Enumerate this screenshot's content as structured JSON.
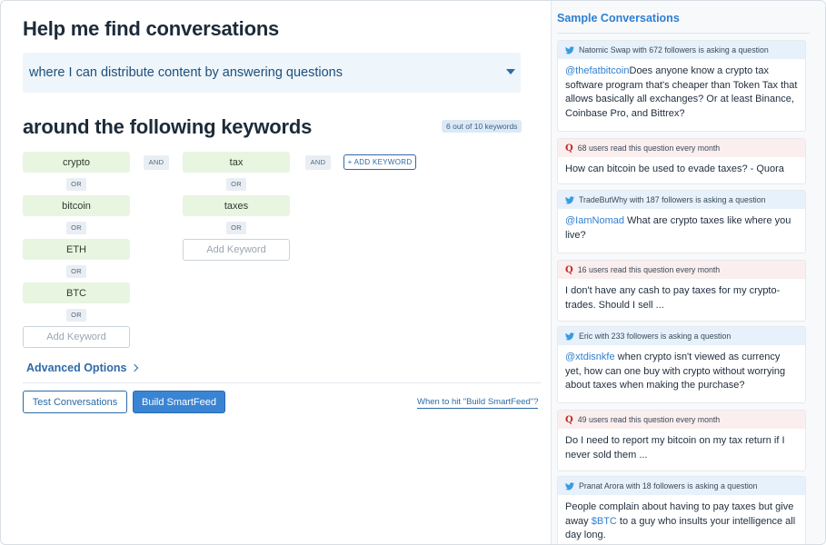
{
  "left": {
    "title": "Help me find conversations",
    "intent": {
      "value": "where I can distribute content by answering questions"
    },
    "keywords_title": "around the following keywords",
    "keywords_count": "6 out of 10 keywords",
    "groups": [
      {
        "keywords": [
          "crypto",
          "bitcoin",
          "ETH",
          "BTC"
        ],
        "or_label": "OR",
        "add_placeholder": "Add Keyword"
      },
      {
        "keywords": [
          "tax",
          "taxes"
        ],
        "or_label": "OR",
        "add_placeholder": "Add Keyword"
      }
    ],
    "and_label": "AND",
    "add_keyword_button": "+ ADD KEYWORD",
    "advanced_options": "Advanced Options",
    "test_button": "Test Conversations",
    "build_button": "Build SmartFeed",
    "when_link": "When to hit \"Build SmartFeed\"?"
  },
  "sidebar": {
    "title": "Sample Conversations",
    "cards": [
      {
        "source": "twitter",
        "header": "Natomic Swap with 672 followers is asking a question",
        "mention": "@thefatbitcoin",
        "text": "Does anyone know a crypto tax software program that's cheaper than Token Tax that allows basically all exchanges? Or at least Binance, Coinbase Pro, and Bittrex?"
      },
      {
        "source": "quora",
        "header": "68 users read this question every month",
        "text": "How can bitcoin be used to evade taxes? - Quora"
      },
      {
        "source": "twitter",
        "header": "TradeButWhy with 187 followers is asking a question",
        "mention": "@IamNomad",
        "text": " What are crypto taxes like where you live?"
      },
      {
        "source": "quora",
        "header": "16 users read this question every month",
        "text": "I don't have any cash to pay taxes for my crypto-trades. Should I sell ..."
      },
      {
        "source": "twitter",
        "header": "Eric with 233 followers is asking a question",
        "mention": "@xtdisnkfe",
        "text": " when crypto isn't viewed as currency yet, how can one buy with crypto without worrying about taxes when making the purchase?"
      },
      {
        "source": "quora",
        "header": "49 users read this question every month",
        "text": "Do I need to report my bitcoin on my tax return if I never sold them ..."
      },
      {
        "source": "twitter",
        "header": "Pranat Arora with 18 followers is asking a question",
        "text_before": "People complain about having to pay taxes but give away ",
        "mention": "$BTC",
        "text_after": " to a guy who insults your intelligence all day long."
      }
    ]
  },
  "colors": {
    "accent": "#2f7fd0",
    "chip_bg": "#e8f5e1",
    "twitter_head": "#e6f1fb",
    "quora_head": "#fbeeee",
    "quora_icon": "#b92b27"
  }
}
